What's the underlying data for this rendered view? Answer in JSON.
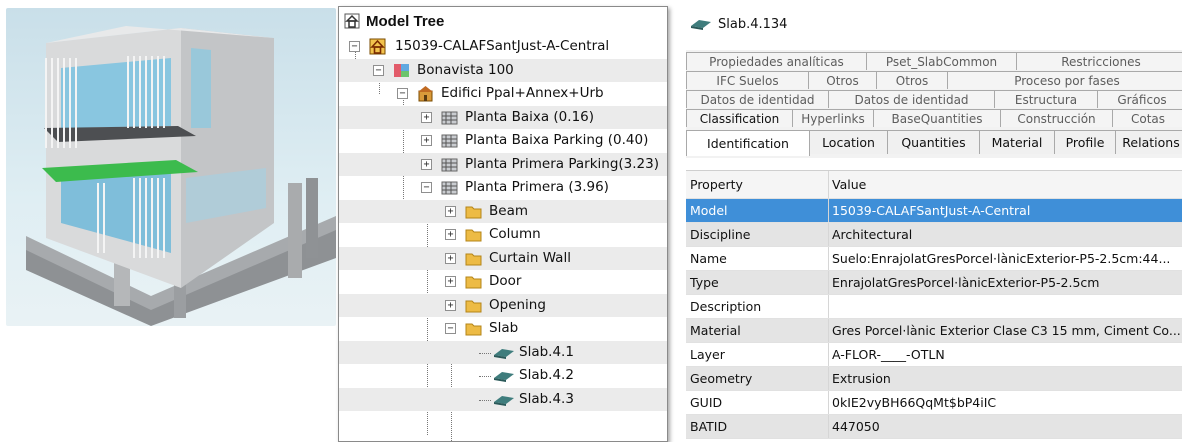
{
  "tree": {
    "title": "Model Tree",
    "items": [
      {
        "label": "15039-CALAFSantJust-A-Central",
        "expander": "−",
        "icon": "house-icon"
      },
      {
        "label": "Bonavista 100",
        "expander": "−",
        "icon": "site-icon"
      },
      {
        "label": "Edifici Ppal+Annex+Urb",
        "expander": "−",
        "icon": "building-icon"
      },
      {
        "label": "Planta Baixa (0.16)",
        "expander": "+",
        "icon": "storey-icon"
      },
      {
        "label": "Planta Baixa Parking (0.40)",
        "expander": "+",
        "icon": "storey-icon"
      },
      {
        "label": "Planta Primera Parking(3.23)",
        "expander": "+",
        "icon": "storey-icon"
      },
      {
        "label": "Planta Primera (3.96)",
        "expander": "−",
        "icon": "storey-icon"
      },
      {
        "label": "Beam",
        "expander": "+",
        "icon": "folder-icon"
      },
      {
        "label": "Column",
        "expander": "+",
        "icon": "folder-icon"
      },
      {
        "label": "Curtain Wall",
        "expander": "+",
        "icon": "folder-icon"
      },
      {
        "label": "Door",
        "expander": "+",
        "icon": "folder-icon"
      },
      {
        "label": "Opening",
        "expander": "+",
        "icon": "folder-icon"
      },
      {
        "label": "Slab",
        "expander": "−",
        "icon": "folder-icon"
      },
      {
        "label": "Slab.4.1",
        "expander": "",
        "icon": "slab-icon"
      },
      {
        "label": "Slab.4.2",
        "expander": "",
        "icon": "slab-icon"
      },
      {
        "label": "Slab.4.3",
        "expander": "",
        "icon": "slab-icon"
      }
    ]
  },
  "properties": {
    "selected": "Slab.4.134",
    "tab_rows": [
      [
        "Propiedades analíticas",
        "Pset_SlabCommon",
        "Restricciones"
      ],
      [
        "IFC Suelos",
        "Otros",
        "Otros",
        "Proceso por fases"
      ],
      [
        "Datos de identidad",
        "Datos de identidad",
        "Estructura",
        "Gráficos"
      ],
      [
        "Classification",
        "Hyperlinks",
        "BaseQuantities",
        "Construcción",
        "Cotas"
      ],
      [
        "Identification",
        "Location",
        "Quantities",
        "Material",
        "Profile",
        "Relations"
      ]
    ],
    "active_tab": "Identification",
    "columns": {
      "key": "Property",
      "value": "Value"
    },
    "rows": [
      {
        "k": "Model",
        "v": "15039-CALAFSantJust-A-Central"
      },
      {
        "k": "Discipline",
        "v": "Architectural"
      },
      {
        "k": "Name",
        "v": "Suelo:EnrajolatGresPorcel·lànicExterior-P5-2.5cm:44..."
      },
      {
        "k": "Type",
        "v": "EnrajolatGresPorcel·lànicExterior-P5-2.5cm"
      },
      {
        "k": "Description",
        "v": ""
      },
      {
        "k": "Material",
        "v": "Gres Porcel·lànic Exterior Clase C3 15 mm, Ciment Co..."
      },
      {
        "k": "Layer",
        "v": "A-FLOR-____-OTLN"
      },
      {
        "k": "Geometry",
        "v": "Extrusion"
      },
      {
        "k": "GUID",
        "v": "0kIE2vyBH66QqMt$bP4iIC"
      },
      {
        "k": "BATID",
        "v": "447050"
      }
    ]
  },
  "colors": {
    "selection": "#3f8fd8",
    "glass": "#6fb9d9",
    "green_slab": "#37b64a",
    "folder": "#e8b640"
  }
}
